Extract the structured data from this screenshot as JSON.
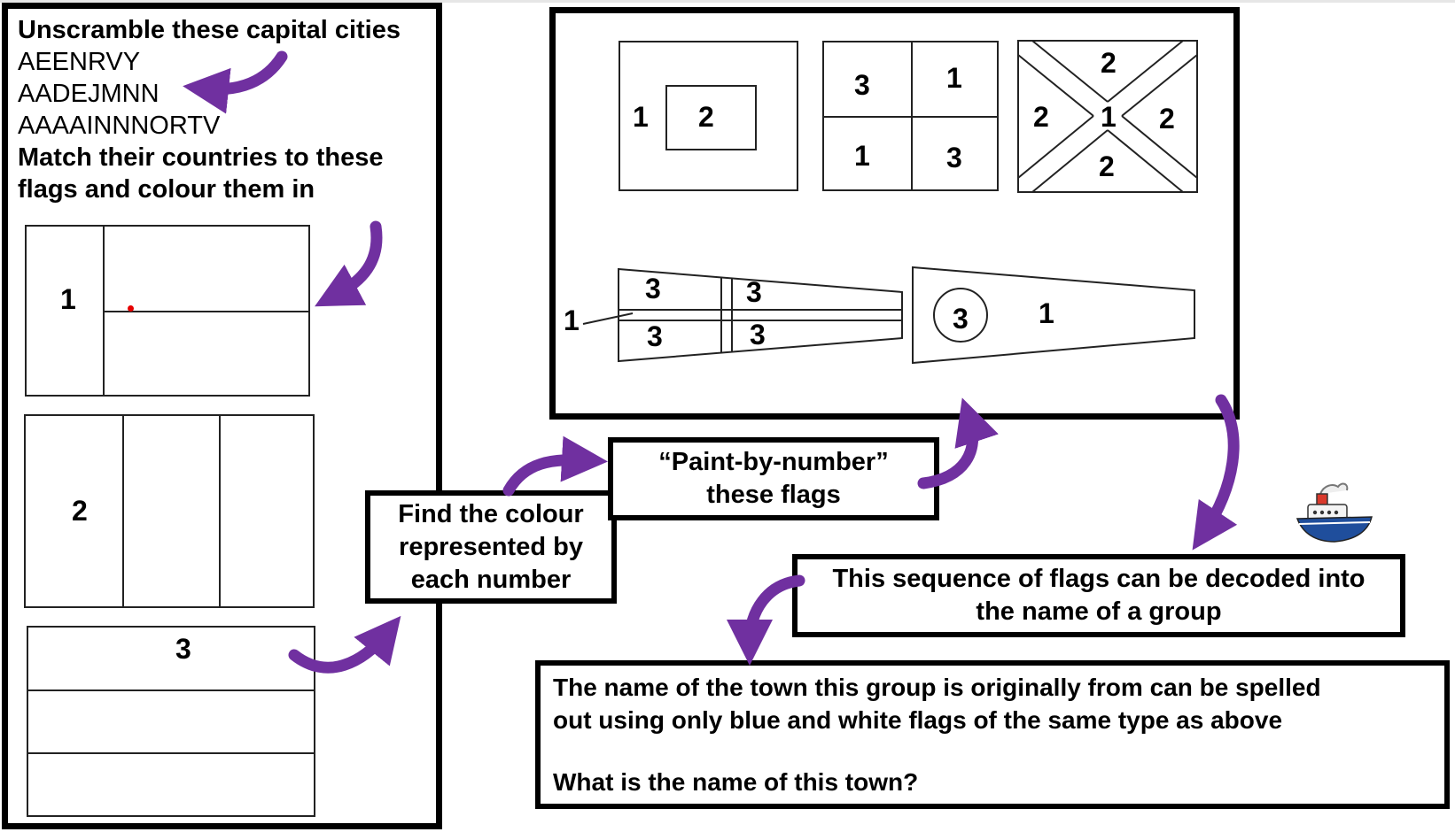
{
  "left_panel": {
    "title": "Unscramble these capital cities",
    "anagrams": [
      "AEENRVY",
      "AADEJMNN",
      "AAAAINNNORTV"
    ],
    "instruction_line1": "Match their countries to these",
    "instruction_line2": "flags and colour them in",
    "flags": [
      {
        "label": "1"
      },
      {
        "label": "2"
      },
      {
        "label": "3"
      }
    ]
  },
  "top_panel": {
    "flag_a": {
      "outer": "1",
      "inner": "2"
    },
    "flag_b": {
      "tl": "3",
      "tr": "1",
      "bl": "1",
      "br": "3"
    },
    "flag_c": {
      "top": "2",
      "left": "2",
      "center": "1",
      "right": "2",
      "bottom": "2"
    },
    "pennant_a": {
      "tl": "3",
      "tr": "3",
      "bl": "3",
      "br": "3",
      "cross": "1"
    },
    "pennant_b": {
      "circle": "3",
      "field": "1"
    }
  },
  "boxes": {
    "find_colour": [
      "Find the colour",
      "represented by",
      "each number"
    ],
    "paint_by_number": [
      "“Paint-by-number”",
      "these flags"
    ],
    "sequence": [
      "This sequence of flags can be decoded into",
      "the name of a group"
    ],
    "town_line1": "The name of the town this group is originally from can be spelled",
    "town_line2": "out using only blue and white flags of the same type as above",
    "town_question": "What is the name of this town?"
  },
  "colors": {
    "arrow": "#7030a0",
    "border": "#000000",
    "ship_hull": "#1f4e9c",
    "ship_funnel": "#d9392b",
    "marker_dot": "#e60000"
  },
  "icons": [
    "curved-arrow-icon",
    "ship-icon"
  ]
}
